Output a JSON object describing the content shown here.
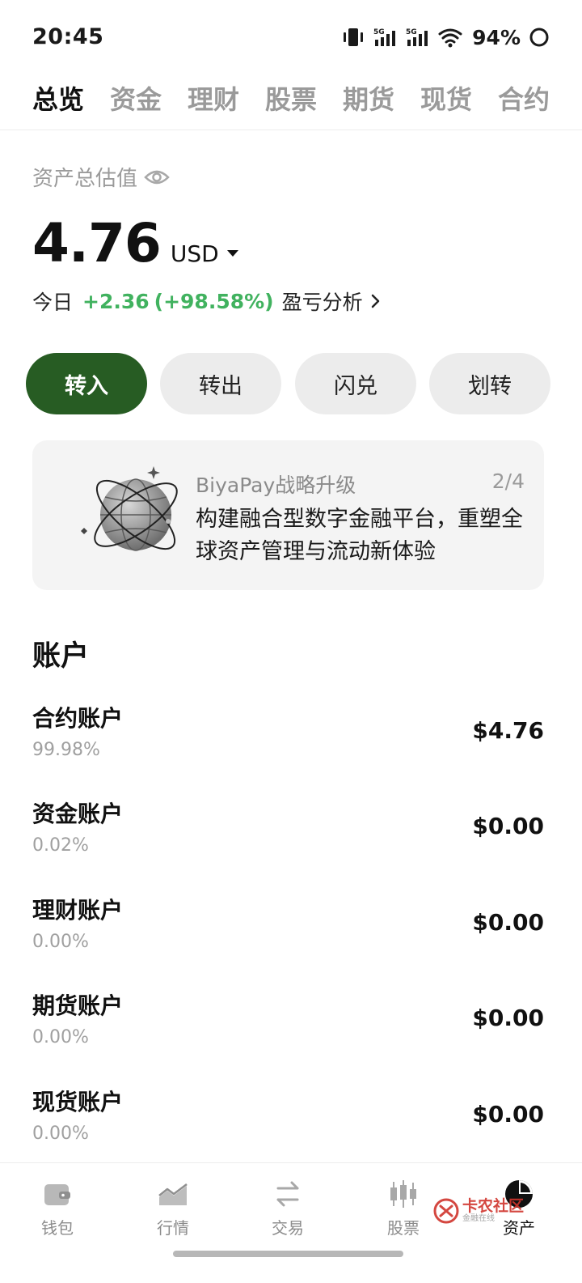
{
  "status_bar": {
    "time": "20:45",
    "signal_1_label": "5G",
    "signal_2_label": "5G",
    "battery": "94%"
  },
  "tabs": [
    {
      "label": "总览",
      "active": true
    },
    {
      "label": "资金",
      "active": false
    },
    {
      "label": "理财",
      "active": false
    },
    {
      "label": "股票",
      "active": false
    },
    {
      "label": "期货",
      "active": false
    },
    {
      "label": "现货",
      "active": false
    },
    {
      "label": "合约",
      "active": false
    }
  ],
  "summary": {
    "label": "资产总估值",
    "total": "4.76",
    "currency": "USD",
    "today_label": "今日",
    "today_change": "+2.36",
    "today_change_pct": "(+98.58%)",
    "pnl_link": "盈亏分析"
  },
  "actions": [
    {
      "label": "转入",
      "primary": true
    },
    {
      "label": "转出",
      "primary": false
    },
    {
      "label": "闪兑",
      "primary": false
    },
    {
      "label": "划转",
      "primary": false
    }
  ],
  "banner": {
    "title": "BiyaPay战略升级",
    "page": "2/4",
    "body": "构建融合型数字金融平台，重塑全球资产管理与流动新体验"
  },
  "accounts": {
    "title": "账户",
    "items": [
      {
        "name": "合约账户",
        "pct": "99.98%",
        "value": "$4.76"
      },
      {
        "name": "资金账户",
        "pct": "0.02%",
        "value": "$0.00"
      },
      {
        "name": "理财账户",
        "pct": "0.00%",
        "value": "$0.00"
      },
      {
        "name": "期货账户",
        "pct": "0.00%",
        "value": "$0.00"
      },
      {
        "name": "现货账户",
        "pct": "0.00%",
        "value": "$0.00"
      }
    ]
  },
  "bottom_nav": [
    {
      "label": "钱包",
      "icon": "wallet-icon",
      "active": false
    },
    {
      "label": "行情",
      "icon": "market-chart-icon",
      "active": false
    },
    {
      "label": "交易",
      "icon": "swap-arrows-icon",
      "active": false
    },
    {
      "label": "股票",
      "icon": "candlestick-icon",
      "active": false
    },
    {
      "label": "资产",
      "icon": "pie-chart-icon",
      "active": true
    }
  ],
  "watermark": {
    "main": "卡农社区",
    "sub": "金融在线"
  },
  "colors": {
    "accent_green": "#275c23",
    "profit_green": "#41b25f",
    "inactive_gray": "#9a9a9a",
    "watermark_red": "#d0342c"
  }
}
